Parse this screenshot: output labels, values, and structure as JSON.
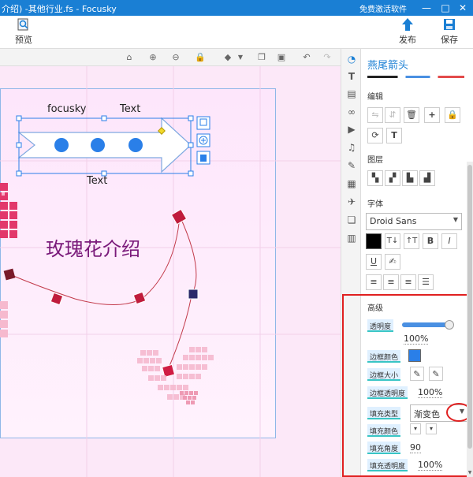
{
  "window": {
    "title": "介绍) -其他行业.fs - Focusky",
    "promo": "免费激活软件",
    "minimize_glyph": "—",
    "maximize_glyph": "□",
    "close_glyph": "✕"
  },
  "toolbar": {
    "preview_label": "预览",
    "publish_label": "发布",
    "save_label": "保存"
  },
  "canvas": {
    "text_left": "focusky",
    "text_right": "Text",
    "text_bottom": "Text",
    "heading": "玫瑰花介绍"
  },
  "panel": {
    "title": "燕尾箭头",
    "edit_label": "编辑",
    "layer_label": "图层",
    "font_label": "字体",
    "font_value": "Droid Sans",
    "advanced_label": "高级",
    "opacity_label": "透明度",
    "opacity_value": "100%",
    "opacity_level": 1.0,
    "border_color_label": "边框颜色",
    "border_size_label": "边框大小",
    "border_opacity_label": "边框透明度",
    "border_opacity_value": "100%",
    "fill_type_label": "填充类型",
    "fill_type_value": "渐变色",
    "fill_color_label": "填充颜色",
    "fill_angle_label": "填充角度",
    "fill_angle_value": "90",
    "fill_opacity_label": "填充透明度",
    "fill_opacity_value": "100%"
  },
  "colors": {
    "accent": "#1a7fd4",
    "highlight_red": "#e02020",
    "canvas_pink": "#fce8f8",
    "heading_purple": "#7a1a7a",
    "curve_red": "#c23a4a"
  }
}
